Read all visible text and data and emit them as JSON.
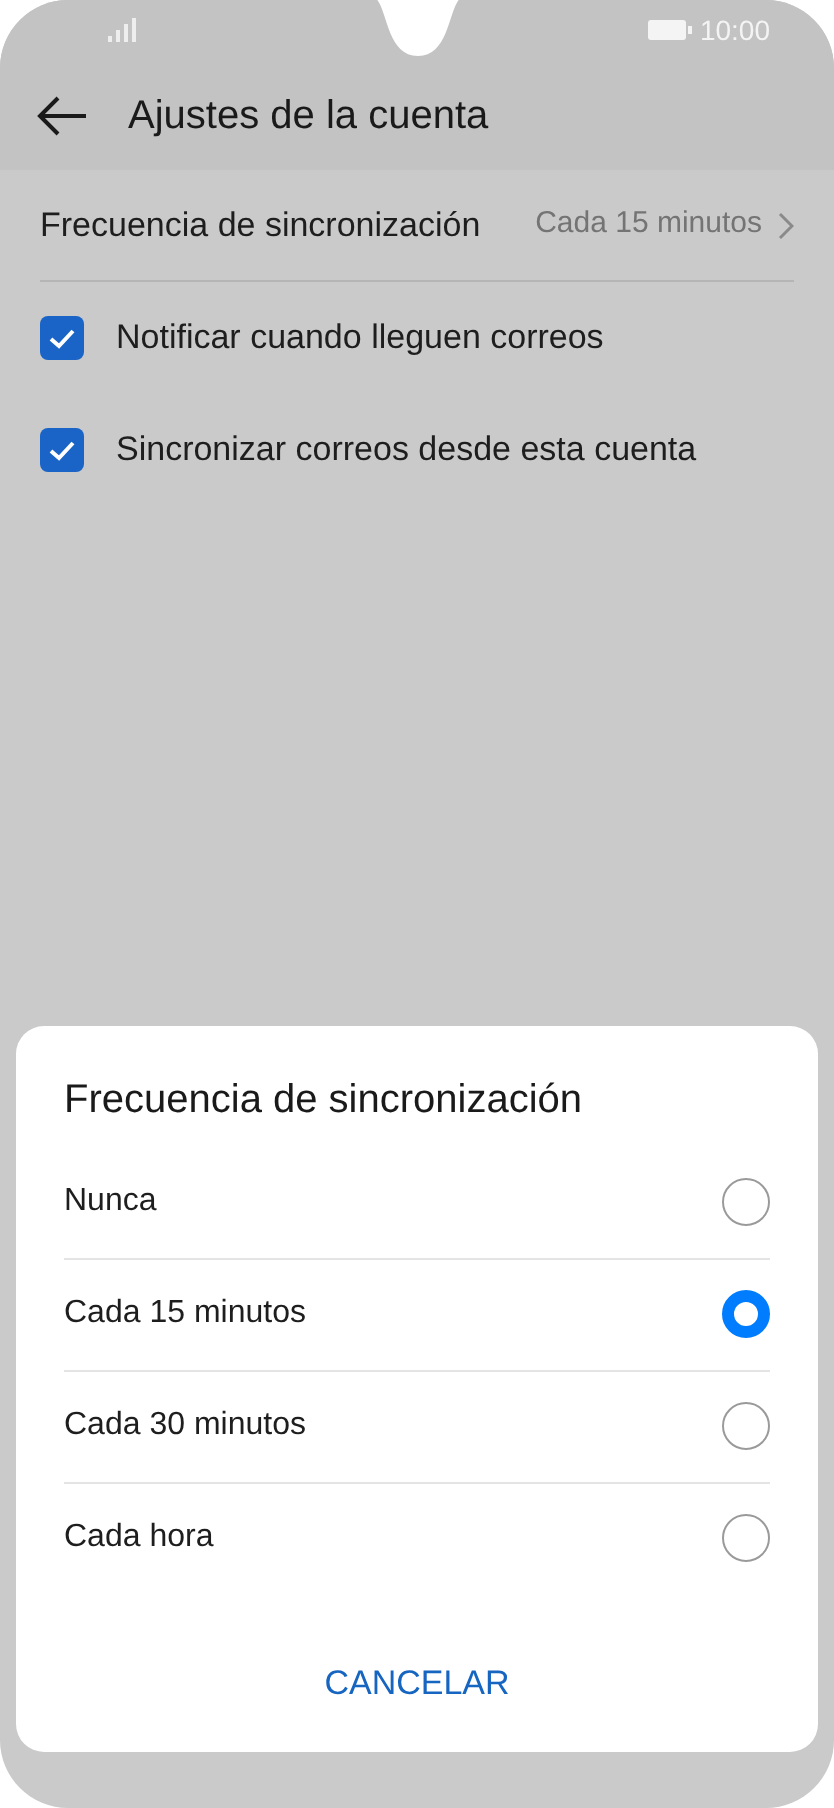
{
  "status_bar": {
    "time": "10:00"
  },
  "app_bar": {
    "title": "Ajustes de la cuenta"
  },
  "settings": [
    {
      "kind": "value",
      "label": "Frecuencia de sincronización",
      "value": "Cada 15 minutos"
    },
    {
      "kind": "checkbox",
      "label": "Notificar cuando lleguen correos",
      "checked": true
    },
    {
      "kind": "checkbox",
      "label": "Sincronizar correos desde esta cuenta",
      "checked": true
    }
  ],
  "dialog": {
    "title": "Frecuencia de sincronización",
    "options": [
      {
        "label": "Nunca",
        "selected": false
      },
      {
        "label": "Cada 15 minutos",
        "selected": true
      },
      {
        "label": "Cada 30 minutos",
        "selected": false
      },
      {
        "label": "Cada hora",
        "selected": false
      }
    ],
    "button": "CANCELAR"
  }
}
